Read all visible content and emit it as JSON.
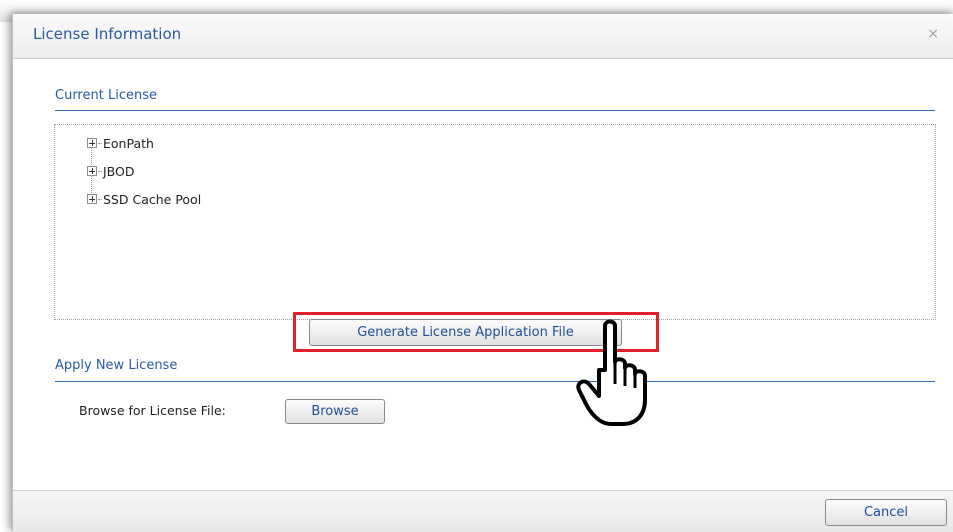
{
  "dialog": {
    "title": "License Information",
    "close_icon": "close-icon",
    "close_glyph": "×"
  },
  "current_license": {
    "section_title": "Current License",
    "tree_items": [
      {
        "label": "EonPath",
        "expander_icon": "plus-expand-icon"
      },
      {
        "label": "JBOD",
        "expander_icon": "plus-expand-icon"
      },
      {
        "label": "SSD Cache Pool",
        "expander_icon": "plus-expand-icon"
      }
    ],
    "generate_button_label": "Generate License Application File"
  },
  "apply_new_license": {
    "section_title": "Apply New License",
    "browse_label": "Browse for License File:",
    "browse_button_label": "Browse"
  },
  "footer": {
    "cancel_button_label": "Cancel"
  },
  "annotations": {
    "highlight_color": "#e0202a",
    "pointer_icon": "hand-pointer-icon"
  },
  "colors": {
    "accent": "#2a5aa0",
    "section_line": "#3a6db0"
  }
}
